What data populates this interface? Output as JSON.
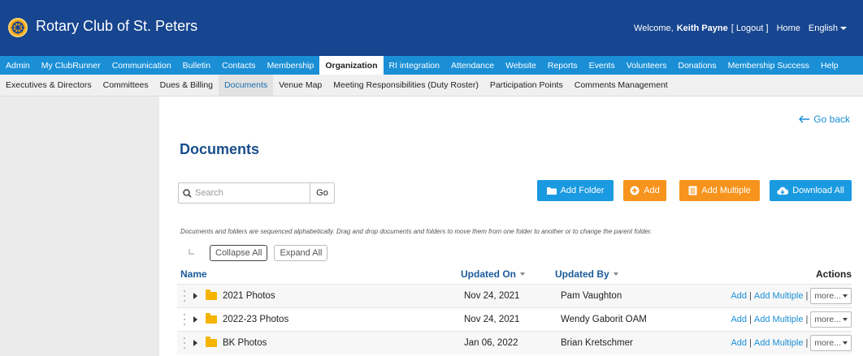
{
  "header": {
    "site_title": "Rotary Club of St. Peters",
    "welcome_prefix": "Welcome,",
    "user_name": "Keith Payne",
    "logout": "[ Logout ]",
    "home": "Home",
    "language": "English"
  },
  "main_nav": [
    "Admin",
    "My ClubRunner",
    "Communication",
    "Bulletin",
    "Contacts",
    "Membership",
    "Organization",
    "RI integration",
    "Attendance",
    "Website",
    "Reports",
    "Events",
    "Volunteers",
    "Donations",
    "Membership Success",
    "Help"
  ],
  "main_nav_active": "Organization",
  "sub_nav": [
    "Executives & Directors",
    "Committees",
    "Dues & Billing",
    "Documents",
    "Venue Map",
    "Meeting Responsibilities (Duty Roster)",
    "Participation Points",
    "Comments Management"
  ],
  "sub_nav_active": "Documents",
  "go_back": "Go back",
  "page_title": "Documents",
  "search": {
    "placeholder": "Search",
    "go_label": "Go"
  },
  "buttons": {
    "add_folder": "Add Folder",
    "add": "Add",
    "add_multiple": "Add Multiple",
    "download_all": "Download All"
  },
  "info_text": "Documents and folders are sequenced alphabetically. Drag and drop documents and folders to move them from one folder to another or to change the parent folder.",
  "collapse_all": "Collapse All",
  "expand_all": "Expand All",
  "table": {
    "headers": {
      "name": "Name",
      "updated_on": "Updated On",
      "updated_by": "Updated By",
      "actions": "Actions"
    },
    "rows": [
      {
        "name": "2021 Photos",
        "updated_on": "Nov 24, 2021",
        "updated_by": "Pam Vaughton"
      },
      {
        "name": "2022-23 Photos",
        "updated_on": "Nov 24, 2021",
        "updated_by": "Wendy Gaborit OAM"
      },
      {
        "name": "BK Photos",
        "updated_on": "Jan 06, 2022",
        "updated_by": "Brian Kretschmer"
      }
    ],
    "row_actions": {
      "add": "Add",
      "add_multiple": "Add Multiple",
      "more": "more..."
    }
  },
  "colors": {
    "topbar": "#17458f",
    "nav": "#1a8fd6",
    "orange": "#f7941d",
    "folder": "#f5b400"
  },
  "icons": [
    "rotary-logo-icon",
    "search-icon",
    "folder-icon",
    "plus-circle-icon",
    "multi-doc-icon",
    "cloud-download-icon",
    "arrow-left-icon",
    "drag-handle-icon",
    "expand-arrow-icon"
  ]
}
